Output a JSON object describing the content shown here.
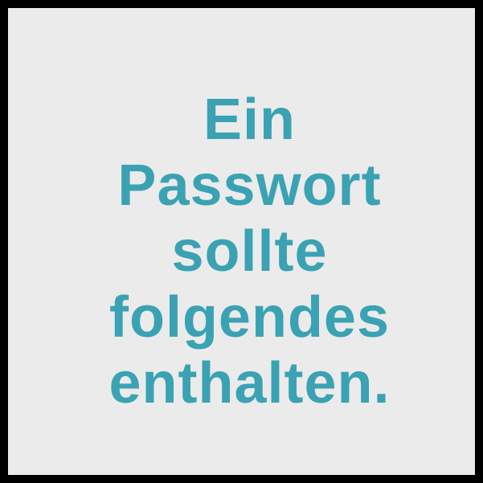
{
  "card": {
    "lines": [
      "Ein",
      "Passwort",
      "sollte",
      "folgendes",
      "enthalten."
    ]
  },
  "colors": {
    "text": "#3aa2b3",
    "background": "#ebebeb",
    "border": "#000000"
  }
}
